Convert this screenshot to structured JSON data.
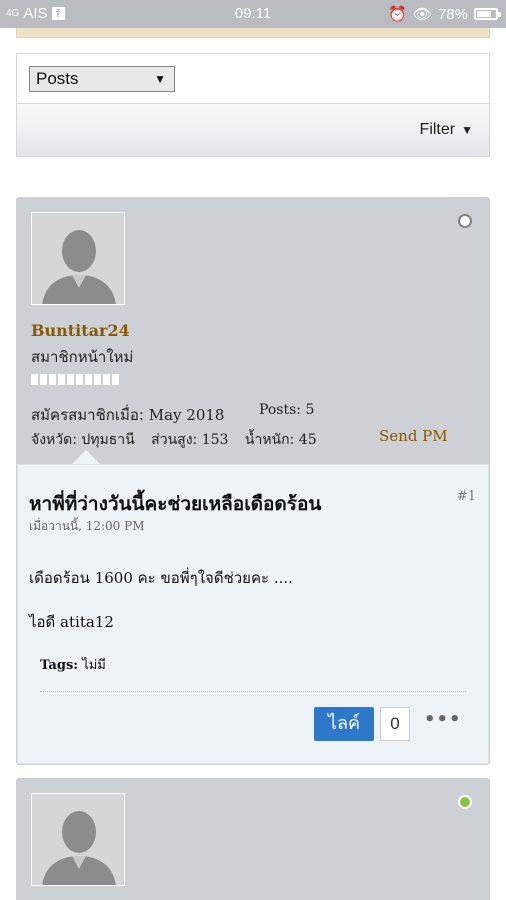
{
  "status_bar": {
    "carrier": "AIS",
    "signal": "4G",
    "fb": "f",
    "time": "09:11",
    "battery": "78%",
    "battery_level": 0.78
  },
  "filter_panel": {
    "select_value": "Posts",
    "filter_label": "Filter"
  },
  "post": {
    "username": "Buntitar24",
    "user_title": "สมาชิกหน้าใหม่",
    "joined_label": "สมัครสมาชิกเมื่อ:",
    "joined_value": "May 2018",
    "posts_label": "Posts:",
    "posts_value": "5",
    "province_label": "จังหวัด:",
    "province_value": "ปทุมธานี",
    "height_label": "ส่วนสูง:",
    "height_value": "153",
    "weight_label": "น้ำหนัก:",
    "weight_value": "45",
    "send_pm": "Send PM",
    "title": "หาพี่ที่ว่างวันนี้คะช่วยเหลือเดือดร้อน",
    "number": "#1",
    "date": "เมื่อวานนี้, 12:00 PM",
    "body_line1": "เดือดร้อน 1600 คะ ขอพี่ๆใจดีช่วยคะ ....",
    "body_line2": "ไอดี atita12",
    "tags_label": "Tags:",
    "tags_value": "ไม่มี",
    "like_label": "ไลค์",
    "like_count": "0",
    "more": "•••"
  },
  "colors": {
    "card_bg": "#cdd0d4",
    "username": "#8a5a00",
    "like_button": "#2d78c8",
    "online": "#86c440"
  }
}
